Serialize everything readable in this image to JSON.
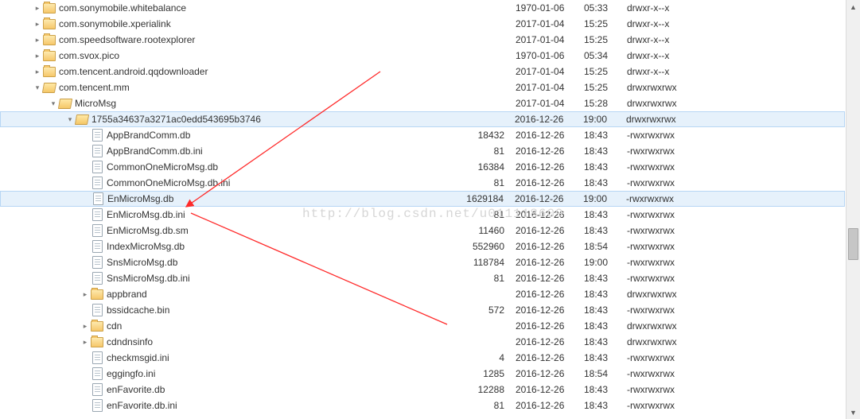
{
  "watermark": "http://blog.csdn.net/u011118609",
  "base_indent": 40,
  "per_level_indent": 20,
  "rows": [
    {
      "depth": 0,
      "kind": "folder-closed",
      "tog": "r",
      "name": "com.sonymobile.whitebalance",
      "size": "",
      "date": "1970-01-06",
      "time": "05:33",
      "perm": "drwxr-x--x"
    },
    {
      "depth": 0,
      "kind": "folder-closed",
      "tog": "r",
      "name": "com.sonymobile.xperialink",
      "size": "",
      "date": "2017-01-04",
      "time": "15:25",
      "perm": "drwxr-x--x"
    },
    {
      "depth": 0,
      "kind": "folder-closed",
      "tog": "r",
      "name": "com.speedsoftware.rootexplorer",
      "size": "",
      "date": "2017-01-04",
      "time": "15:25",
      "perm": "drwxr-x--x"
    },
    {
      "depth": 0,
      "kind": "folder-closed",
      "tog": "r",
      "name": "com.svox.pico",
      "size": "",
      "date": "1970-01-06",
      "time": "05:34",
      "perm": "drwxr-x--x"
    },
    {
      "depth": 0,
      "kind": "folder-closed",
      "tog": "r",
      "name": "com.tencent.android.qqdownloader",
      "size": "",
      "date": "2017-01-04",
      "time": "15:25",
      "perm": "drwxr-x--x"
    },
    {
      "depth": 0,
      "kind": "folder-open",
      "tog": "d",
      "name": "com.tencent.mm",
      "size": "",
      "date": "2017-01-04",
      "time": "15:25",
      "perm": "drwxrwxrwx"
    },
    {
      "depth": 1,
      "kind": "folder-open",
      "tog": "d",
      "name": "MicroMsg",
      "size": "",
      "date": "2017-01-04",
      "time": "15:28",
      "perm": "drwxrwxrwx"
    },
    {
      "depth": 2,
      "kind": "folder-open",
      "tog": "d",
      "name": "1755a34637a3271ac0edd543695b3746",
      "size": "",
      "date": "2016-12-26",
      "time": "19:00",
      "perm": "drwxrwxrwx",
      "group_sel": true
    },
    {
      "depth": 3,
      "kind": "file",
      "tog": "",
      "name": "AppBrandComm.db",
      "size": "18432",
      "date": "2016-12-26",
      "time": "18:43",
      "perm": "-rwxrwxrwx"
    },
    {
      "depth": 3,
      "kind": "file",
      "tog": "",
      "name": "AppBrandComm.db.ini",
      "size": "81",
      "date": "2016-12-26",
      "time": "18:43",
      "perm": "-rwxrwxrwx"
    },
    {
      "depth": 3,
      "kind": "file",
      "tog": "",
      "name": "CommonOneMicroMsg.db",
      "size": "16384",
      "date": "2016-12-26",
      "time": "18:43",
      "perm": "-rwxrwxrwx"
    },
    {
      "depth": 3,
      "kind": "file",
      "tog": "",
      "name": "CommonOneMicroMsg.db.ini",
      "size": "81",
      "date": "2016-12-26",
      "time": "18:43",
      "perm": "-rwxrwxrwx"
    },
    {
      "depth": 3,
      "kind": "file",
      "tog": "",
      "name": "EnMicroMsg.db",
      "size": "1629184",
      "date": "2016-12-26",
      "time": "19:00",
      "perm": "-rwxrwxrwx",
      "file_sel": true
    },
    {
      "depth": 3,
      "kind": "file",
      "tog": "",
      "name": "EnMicroMsg.db.ini",
      "size": "81",
      "date": "2016-12-26",
      "time": "18:43",
      "perm": "-rwxrwxrwx"
    },
    {
      "depth": 3,
      "kind": "file",
      "tog": "",
      "name": "EnMicroMsg.db.sm",
      "size": "11460",
      "date": "2016-12-26",
      "time": "18:43",
      "perm": "-rwxrwxrwx"
    },
    {
      "depth": 3,
      "kind": "file",
      "tog": "",
      "name": "IndexMicroMsg.db",
      "size": "552960",
      "date": "2016-12-26",
      "time": "18:54",
      "perm": "-rwxrwxrwx"
    },
    {
      "depth": 3,
      "kind": "file",
      "tog": "",
      "name": "SnsMicroMsg.db",
      "size": "118784",
      "date": "2016-12-26",
      "time": "19:00",
      "perm": "-rwxrwxrwx"
    },
    {
      "depth": 3,
      "kind": "file",
      "tog": "",
      "name": "SnsMicroMsg.db.ini",
      "size": "81",
      "date": "2016-12-26",
      "time": "18:43",
      "perm": "-rwxrwxrwx"
    },
    {
      "depth": 3,
      "kind": "folder-closed",
      "tog": "r",
      "name": "appbrand",
      "size": "",
      "date": "2016-12-26",
      "time": "18:43",
      "perm": "drwxrwxrwx"
    },
    {
      "depth": 3,
      "kind": "file",
      "tog": "",
      "name": "bssidcache.bin",
      "size": "572",
      "date": "2016-12-26",
      "time": "18:43",
      "perm": "-rwxrwxrwx"
    },
    {
      "depth": 3,
      "kind": "folder-closed",
      "tog": "r",
      "name": "cdn",
      "size": "",
      "date": "2016-12-26",
      "time": "18:43",
      "perm": "drwxrwxrwx"
    },
    {
      "depth": 3,
      "kind": "folder-closed",
      "tog": "r",
      "name": "cdndnsinfo",
      "size": "",
      "date": "2016-12-26",
      "time": "18:43",
      "perm": "drwxrwxrwx"
    },
    {
      "depth": 3,
      "kind": "file",
      "tog": "",
      "name": "checkmsgid.ini",
      "size": "4",
      "date": "2016-12-26",
      "time": "18:43",
      "perm": "-rwxrwxrwx"
    },
    {
      "depth": 3,
      "kind": "file",
      "tog": "",
      "name": "eggingfo.ini",
      "size": "1285",
      "date": "2016-12-26",
      "time": "18:54",
      "perm": "-rwxrwxrwx"
    },
    {
      "depth": 3,
      "kind": "file",
      "tog": "",
      "name": "enFavorite.db",
      "size": "12288",
      "date": "2016-12-26",
      "time": "18:43",
      "perm": "-rwxrwxrwx"
    },
    {
      "depth": 3,
      "kind": "file",
      "tog": "",
      "name": "enFavorite.db.ini",
      "size": "81",
      "date": "2016-12-26",
      "time": "18:43",
      "perm": "-rwxrwxrwx"
    }
  ]
}
